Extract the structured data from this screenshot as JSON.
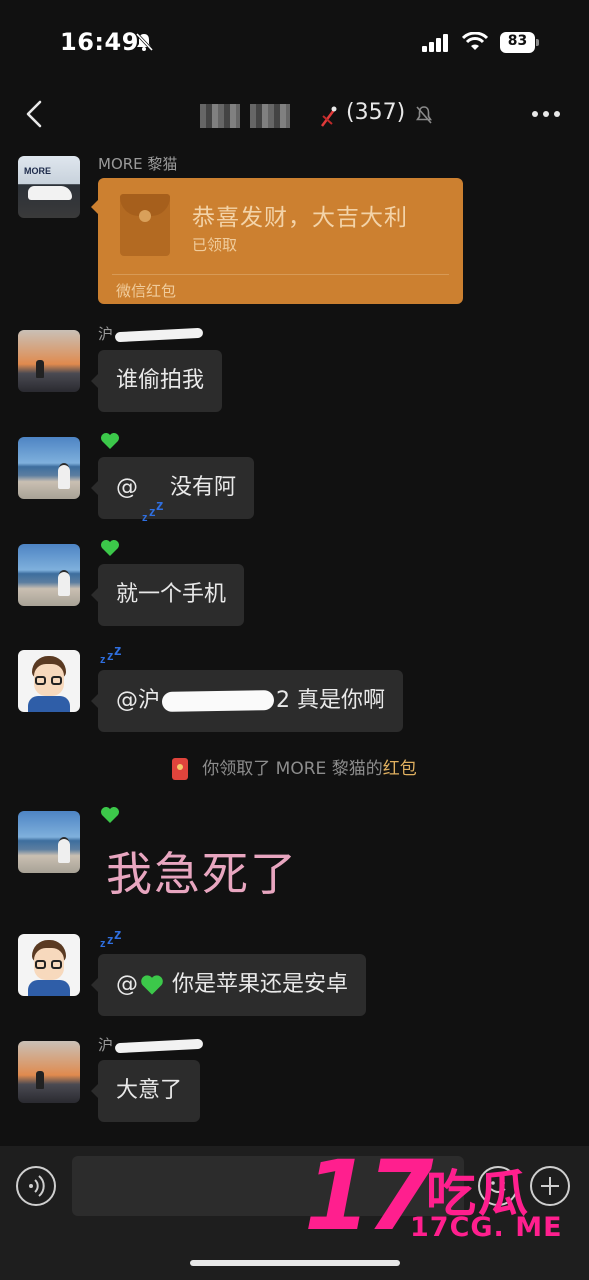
{
  "status_bar": {
    "time": "16:49",
    "battery": "83"
  },
  "nav": {
    "member_count": "(357)"
  },
  "messages": {
    "m1": {
      "sender": "MORE 黎猫",
      "packet_title": "恭喜发财，大吉大利",
      "packet_status": "已领取",
      "packet_footer": "微信红包"
    },
    "m2": {
      "sender_prefix": "沪",
      "text": "谁偷拍我"
    },
    "m3": {
      "prefix": "@",
      "text": "没有阿"
    },
    "m4": {
      "text": "就一个手机"
    },
    "m5": {
      "prefix": "@沪",
      "suffix": "2 真是你啊"
    },
    "m6": {
      "text": "我急死了"
    },
    "m7": {
      "prefix": "@",
      "text": "你是苹果还是安卓"
    },
    "m8": {
      "sender_prefix": "沪",
      "text": "大意了"
    }
  },
  "system_notice": {
    "text": "你领取了 MORE 黎猫的",
    "link": "红包"
  },
  "input": {
    "placeholder": ""
  },
  "watermark": {
    "number": "17",
    "brand": "吃瓜",
    "url": "17CG. ME"
  },
  "colors": {
    "bubble": "#2c2c2c",
    "packet": "#cc8030",
    "heart": "#3cc84a",
    "zzz": "#2f6fe0",
    "watermark": "#ff1f8e"
  }
}
